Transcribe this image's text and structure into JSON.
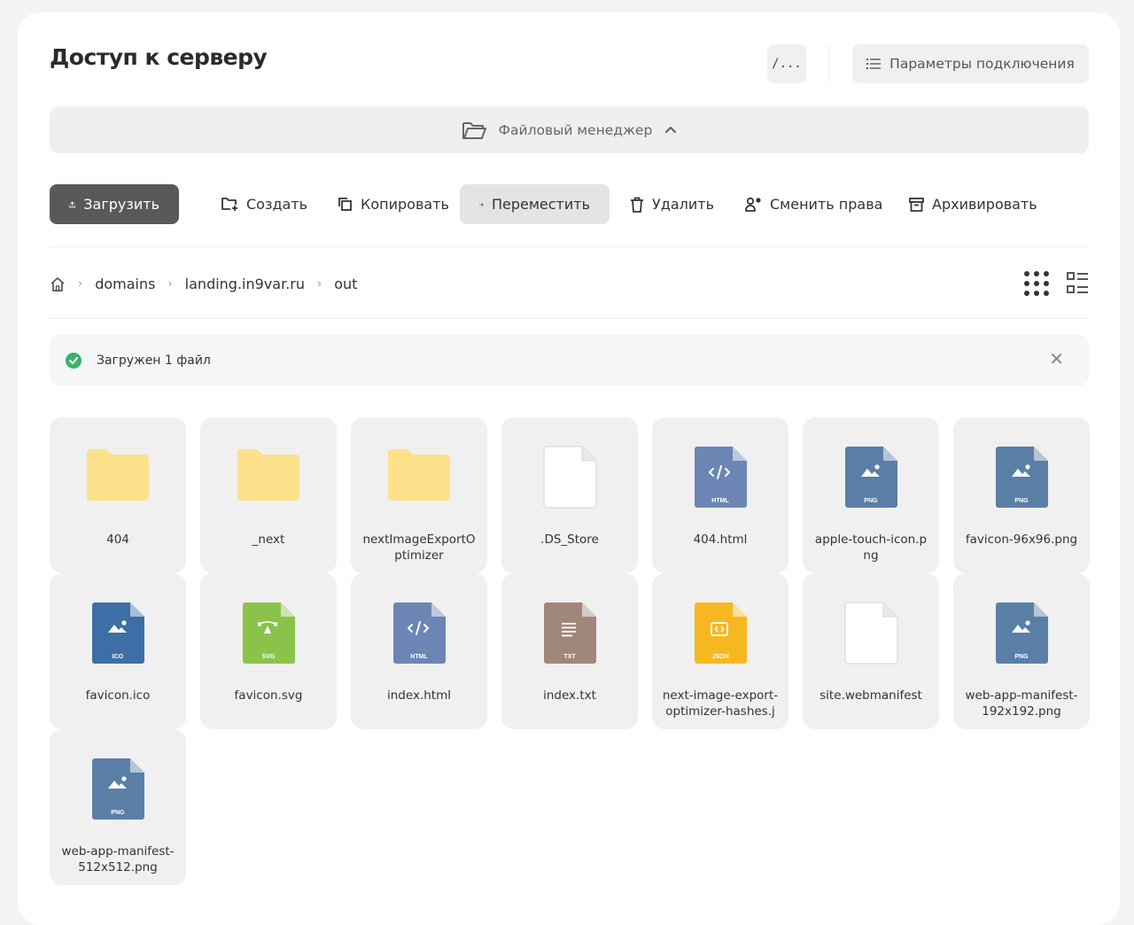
{
  "header": {
    "title": "Доступ к серверу",
    "terminal_label": "/...",
    "params_label": "Параметры подключения"
  },
  "file_manager": {
    "title": "Файловый менеджер"
  },
  "toolbar": {
    "upload": "Загрузить",
    "create": "Создать",
    "copy": "Копировать",
    "move": "Переместить",
    "delete": "Удалить",
    "permissions": "Сменить права",
    "archive": "Архивировать"
  },
  "breadcrumbs": [
    "domains",
    "landing.in9var.ru",
    "out"
  ],
  "alert": {
    "text": "Загружен 1 файл"
  },
  "files": [
    {
      "name": "404",
      "type": "folder"
    },
    {
      "name": "_next",
      "type": "folder"
    },
    {
      "name": "nextImageExportOptimizer",
      "type": "folder"
    },
    {
      "name": ".DS_Store",
      "type": "blank"
    },
    {
      "name": "404.html",
      "type": "html",
      "badge": "HTML"
    },
    {
      "name": "apple-touch-icon.png",
      "type": "image",
      "badge": "PNG"
    },
    {
      "name": "favicon-96x96.png",
      "type": "image",
      "badge": "PNG"
    },
    {
      "name": "favicon.ico",
      "type": "ico",
      "badge": "ICO"
    },
    {
      "name": "favicon.svg",
      "type": "svg",
      "badge": "SVG"
    },
    {
      "name": "index.html",
      "type": "html",
      "badge": "HTML"
    },
    {
      "name": "index.txt",
      "type": "txt",
      "badge": "TXT"
    },
    {
      "name": "next-image-export-optimizer-hashes.j",
      "type": "json",
      "badge": "JSON"
    },
    {
      "name": "site.webmanifest",
      "type": "blank"
    },
    {
      "name": "web-app-manifest-192x192.png",
      "type": "image",
      "badge": "PNG"
    },
    {
      "name": "web-app-manifest-512x512.png",
      "type": "image",
      "badge": "PNG"
    }
  ],
  "colors": {
    "folder": "#fde08a",
    "image": "#5a7fa6",
    "ico": "#3d6ea5",
    "svg": "#8bc34a",
    "html": "#6b86b4",
    "txt": "#a0877a",
    "json": "#f5b820",
    "success": "#3ab26b",
    "primary_button": "#595959"
  }
}
